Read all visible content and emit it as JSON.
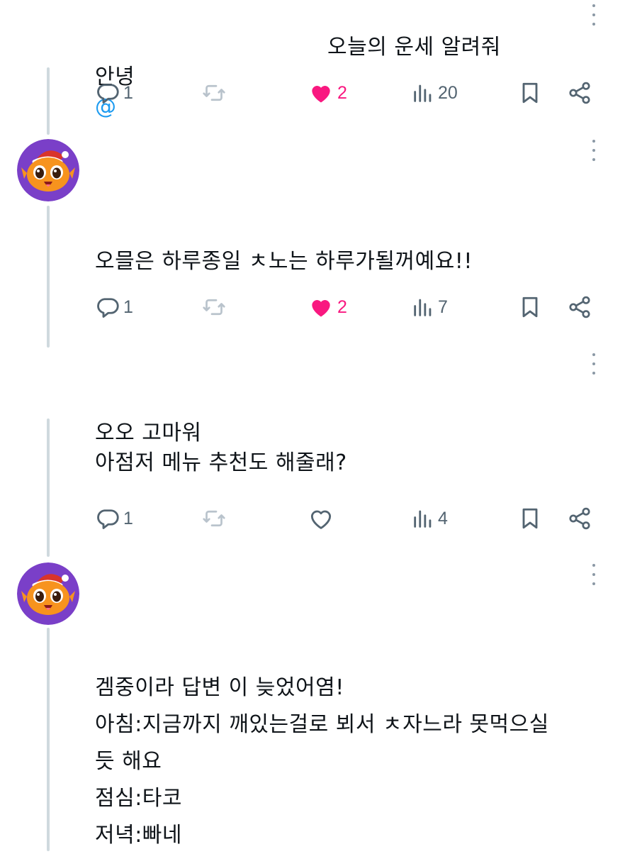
{
  "colors": {
    "like": "#f91880",
    "mention": "#1d9bf0",
    "icon": "#536471",
    "thread_line": "#cfd9de",
    "avatar_bg": "#7a3fc8"
  },
  "posts": [
    {
      "text_left": "안녕",
      "mention": "@",
      "text_right": "오늘의 운세 알려줘",
      "actions": {
        "replies": "1",
        "likes": "2",
        "liked": true,
        "views": "20"
      }
    },
    {
      "avatar_icon": "orange-mascot-santa-hat-icon",
      "text": "오믈은 하루종일 ㅊ노는 하루가될꺼예요!!",
      "actions": {
        "replies": "1",
        "likes": "2",
        "liked": true,
        "views": "7"
      }
    },
    {
      "text": "오오 고마워\n아점저 메뉴 추천도 해줄래?",
      "actions": {
        "replies": "1",
        "likes": "",
        "liked": false,
        "views": "4"
      }
    },
    {
      "avatar_icon": "orange-mascot-santa-hat-icon",
      "text": "겜중이라 답변 이 늦었어염!\n아침:지금까지 깨있는걸로 뵈서 ㅊ자느라 못먹으실\n듯 해요\n점심:타코\n저녁:빠네"
    }
  ]
}
